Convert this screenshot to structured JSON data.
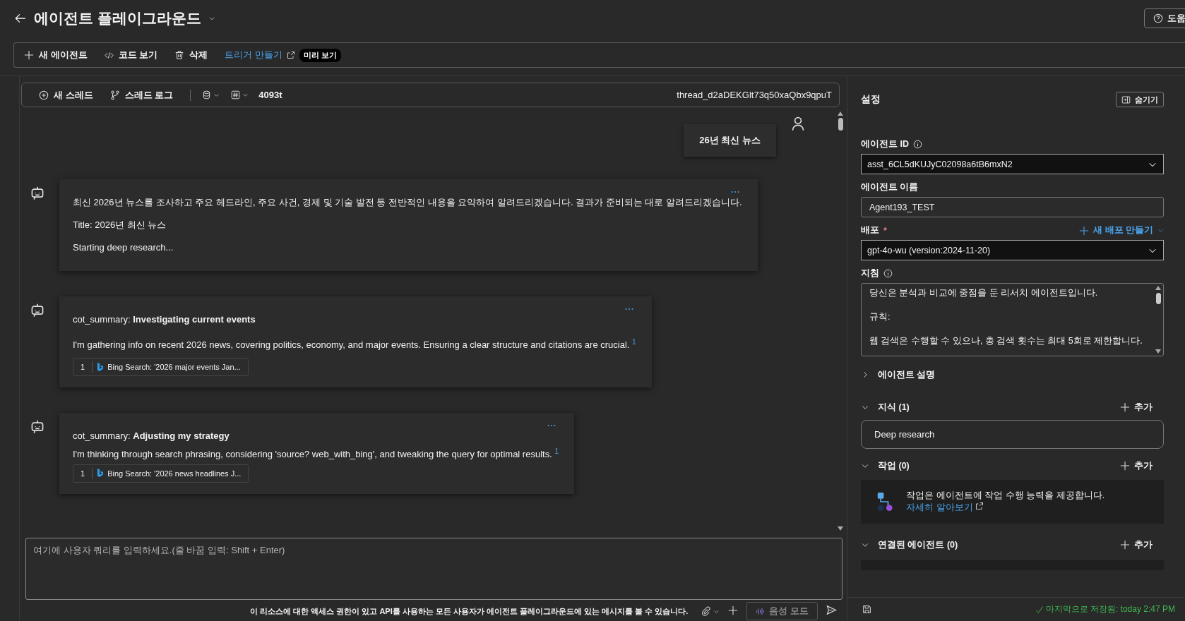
{
  "header": {
    "title": "에이전트 플레이그라운드",
    "help": "도움"
  },
  "toolbar": [
    {
      "kind": "new",
      "label": "새 에이전트"
    },
    {
      "kind": "code",
      "label": "코드 보기"
    },
    {
      "kind": "delete",
      "label": "삭제"
    },
    {
      "kind": "link",
      "label": "트리거 만들기",
      "badge": "미리 보기"
    }
  ],
  "thread_bar": {
    "new_thread": "새 스레드",
    "thread_log": "스레드 로그",
    "tokens": "4093t",
    "thread_id": "thread_d2aDEKGlt73q50xaQbx9qpuT"
  },
  "messages": [
    {
      "kind": "user",
      "text": "26년 최신 뉴스"
    },
    {
      "kind": "agent",
      "compact": false,
      "paragraphs": [
        "최신 2026년 뉴스를 조사하고 주요 헤드라인, 주요 사건, 경제 및 기술 발전 등 전반적인 내용을 요약하여 알려드리겠습니다. 결과가 준비되는 대로 알려드리겠습니다.",
        "Title: 2026년 최신 뉴스",
        "Starting deep research..."
      ]
    },
    {
      "kind": "agent",
      "compact": false,
      "paragraphs": [
        "cot_summary: **Investigating current events**",
        "I'm gathering info on recent 2026 news, covering politics, economy, and major events. Ensuring a clear structure and citations are crucial. $^{1}$"
      ],
      "citation": {
        "number": "1",
        "text": "Bing Search: '2026 major events Jan..."
      }
    },
    {
      "kind": "agent",
      "compact": true,
      "paragraphs": [
        "cot_summary: **Adjusting my strategy**",
        "I'm thinking through search phrasing, considering 'source? web_with_bing', and tweaking the query for optimal results. $^{1}$"
      ],
      "citation": {
        "number": "1",
        "text": "Bing Search: '2026 news headlines J..."
      }
    }
  ],
  "input": {
    "placeholder": "여기에 사용자 쿼리를 입력하세요.(줄 바꿈 입력: Shift + Enter)",
    "notice": "이 리소스에 대한 액세스 권한이 있고 API를 사용하는 모든 사용자가 에이전트 플레이그라운드에 있는 메시지를 볼 수 있습니다.",
    "voice_label": "음성 모드"
  },
  "settings": {
    "title": "설정",
    "hide_button": "숨기기",
    "agent_id": {
      "label": "에이전트 ID",
      "value": "asst_6CL5dKUJyC02098a6tB6mxN2"
    },
    "agent_name": {
      "label": "에이전트 이름",
      "value": "Agent193_TEST"
    },
    "deployment": {
      "label": "배포",
      "required_mark": "*",
      "new_link": "새 배포 만들기",
      "value": "gpt-4o-wu (version:2024-11-20)"
    },
    "instructions": {
      "label": "지침",
      "value": "당신은 분석과 비교에 중점을 둔 리서치 에이전트입니다.\n\n규칙:\n\n웹 검색은 수행할 수 있으나, 총 검색 횟수는 최대 5회로 제한합니다."
    },
    "sections": [
      {
        "kind": "plain",
        "title": "에이전트 설명",
        "expanded": false
      },
      {
        "kind": "list",
        "title": "지식 (1)",
        "expanded": true,
        "add": "추가",
        "items": [
          "Deep research"
        ]
      },
      {
        "kind": "info",
        "title": "작업 (0)",
        "expanded": true,
        "add": "추가",
        "info": "작업은 에이전트에 작업 수행 능력을 제공합니다.",
        "info_link": "자세히 알아보기"
      },
      {
        "kind": "empty",
        "title": "연결된 에이전트 (0)",
        "expanded": true,
        "add": "추가"
      }
    ],
    "saved": "마지막으로 저장됨: today 2:47 PM"
  }
}
